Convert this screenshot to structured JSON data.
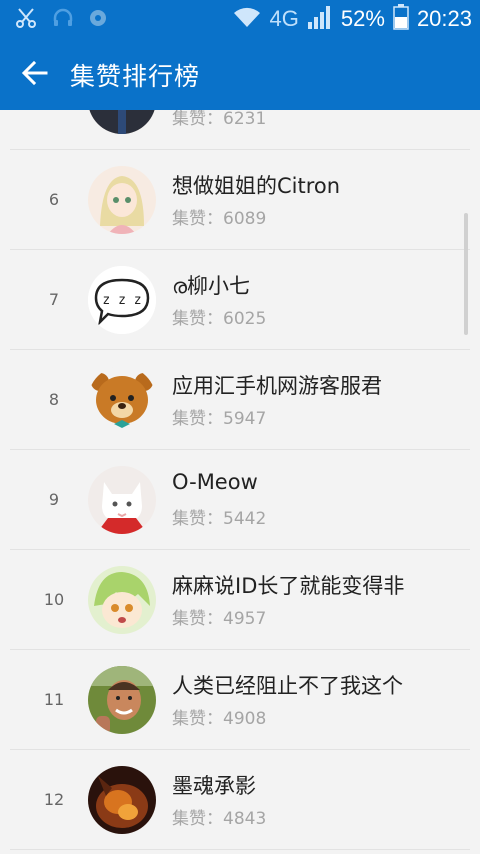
{
  "status": {
    "network": "4G",
    "battery": "52%",
    "time": "20:23"
  },
  "appbar": {
    "title": "集赞排行榜"
  },
  "ranking": {
    "likes_prefix": "集赞：",
    "rows": [
      {
        "rank": "",
        "name": "",
        "likes": "6231"
      },
      {
        "rank": "6",
        "name": "想做姐姐的Citron",
        "likes": "6089"
      },
      {
        "rank": "7",
        "name": "ര柳小七",
        "likes": "6025"
      },
      {
        "rank": "8",
        "name": "应用汇手机网游客服君",
        "likes": "5947"
      },
      {
        "rank": "9",
        "name": "O-Meow",
        "likes": "5442"
      },
      {
        "rank": "10",
        "name": "麻麻说ID长了就能变得非",
        "likes": "4957"
      },
      {
        "rank": "11",
        "name": "人类已经阻止不了我这个",
        "likes": "4908"
      },
      {
        "rank": "12",
        "name": "墨魂承影",
        "likes": "4843"
      }
    ]
  },
  "colors": {
    "primary": "#0a72c9",
    "background": "#f3f3f3"
  }
}
